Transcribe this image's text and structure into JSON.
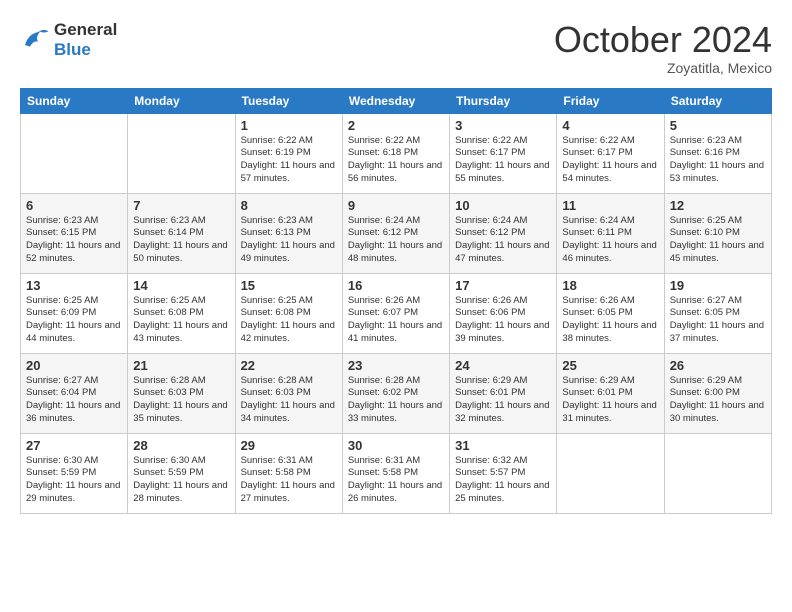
{
  "logo": {
    "line1": "General",
    "line2": "Blue"
  },
  "header": {
    "month": "October 2024",
    "location": "Zoyatitla, Mexico"
  },
  "weekdays": [
    "Sunday",
    "Monday",
    "Tuesday",
    "Wednesday",
    "Thursday",
    "Friday",
    "Saturday"
  ],
  "weeks": [
    [
      {
        "day": "",
        "sunrise": "",
        "sunset": "",
        "daylight": ""
      },
      {
        "day": "",
        "sunrise": "",
        "sunset": "",
        "daylight": ""
      },
      {
        "day": "1",
        "sunrise": "Sunrise: 6:22 AM",
        "sunset": "Sunset: 6:19 PM",
        "daylight": "Daylight: 11 hours and 57 minutes."
      },
      {
        "day": "2",
        "sunrise": "Sunrise: 6:22 AM",
        "sunset": "Sunset: 6:18 PM",
        "daylight": "Daylight: 11 hours and 56 minutes."
      },
      {
        "day": "3",
        "sunrise": "Sunrise: 6:22 AM",
        "sunset": "Sunset: 6:17 PM",
        "daylight": "Daylight: 11 hours and 55 minutes."
      },
      {
        "day": "4",
        "sunrise": "Sunrise: 6:22 AM",
        "sunset": "Sunset: 6:17 PM",
        "daylight": "Daylight: 11 hours and 54 minutes."
      },
      {
        "day": "5",
        "sunrise": "Sunrise: 6:23 AM",
        "sunset": "Sunset: 6:16 PM",
        "daylight": "Daylight: 11 hours and 53 minutes."
      }
    ],
    [
      {
        "day": "6",
        "sunrise": "Sunrise: 6:23 AM",
        "sunset": "Sunset: 6:15 PM",
        "daylight": "Daylight: 11 hours and 52 minutes."
      },
      {
        "day": "7",
        "sunrise": "Sunrise: 6:23 AM",
        "sunset": "Sunset: 6:14 PM",
        "daylight": "Daylight: 11 hours and 50 minutes."
      },
      {
        "day": "8",
        "sunrise": "Sunrise: 6:23 AM",
        "sunset": "Sunset: 6:13 PM",
        "daylight": "Daylight: 11 hours and 49 minutes."
      },
      {
        "day": "9",
        "sunrise": "Sunrise: 6:24 AM",
        "sunset": "Sunset: 6:12 PM",
        "daylight": "Daylight: 11 hours and 48 minutes."
      },
      {
        "day": "10",
        "sunrise": "Sunrise: 6:24 AM",
        "sunset": "Sunset: 6:12 PM",
        "daylight": "Daylight: 11 hours and 47 minutes."
      },
      {
        "day": "11",
        "sunrise": "Sunrise: 6:24 AM",
        "sunset": "Sunset: 6:11 PM",
        "daylight": "Daylight: 11 hours and 46 minutes."
      },
      {
        "day": "12",
        "sunrise": "Sunrise: 6:25 AM",
        "sunset": "Sunset: 6:10 PM",
        "daylight": "Daylight: 11 hours and 45 minutes."
      }
    ],
    [
      {
        "day": "13",
        "sunrise": "Sunrise: 6:25 AM",
        "sunset": "Sunset: 6:09 PM",
        "daylight": "Daylight: 11 hours and 44 minutes."
      },
      {
        "day": "14",
        "sunrise": "Sunrise: 6:25 AM",
        "sunset": "Sunset: 6:08 PM",
        "daylight": "Daylight: 11 hours and 43 minutes."
      },
      {
        "day": "15",
        "sunrise": "Sunrise: 6:25 AM",
        "sunset": "Sunset: 6:08 PM",
        "daylight": "Daylight: 11 hours and 42 minutes."
      },
      {
        "day": "16",
        "sunrise": "Sunrise: 6:26 AM",
        "sunset": "Sunset: 6:07 PM",
        "daylight": "Daylight: 11 hours and 41 minutes."
      },
      {
        "day": "17",
        "sunrise": "Sunrise: 6:26 AM",
        "sunset": "Sunset: 6:06 PM",
        "daylight": "Daylight: 11 hours and 39 minutes."
      },
      {
        "day": "18",
        "sunrise": "Sunrise: 6:26 AM",
        "sunset": "Sunset: 6:05 PM",
        "daylight": "Daylight: 11 hours and 38 minutes."
      },
      {
        "day": "19",
        "sunrise": "Sunrise: 6:27 AM",
        "sunset": "Sunset: 6:05 PM",
        "daylight": "Daylight: 11 hours and 37 minutes."
      }
    ],
    [
      {
        "day": "20",
        "sunrise": "Sunrise: 6:27 AM",
        "sunset": "Sunset: 6:04 PM",
        "daylight": "Daylight: 11 hours and 36 minutes."
      },
      {
        "day": "21",
        "sunrise": "Sunrise: 6:28 AM",
        "sunset": "Sunset: 6:03 PM",
        "daylight": "Daylight: 11 hours and 35 minutes."
      },
      {
        "day": "22",
        "sunrise": "Sunrise: 6:28 AM",
        "sunset": "Sunset: 6:03 PM",
        "daylight": "Daylight: 11 hours and 34 minutes."
      },
      {
        "day": "23",
        "sunrise": "Sunrise: 6:28 AM",
        "sunset": "Sunset: 6:02 PM",
        "daylight": "Daylight: 11 hours and 33 minutes."
      },
      {
        "day": "24",
        "sunrise": "Sunrise: 6:29 AM",
        "sunset": "Sunset: 6:01 PM",
        "daylight": "Daylight: 11 hours and 32 minutes."
      },
      {
        "day": "25",
        "sunrise": "Sunrise: 6:29 AM",
        "sunset": "Sunset: 6:01 PM",
        "daylight": "Daylight: 11 hours and 31 minutes."
      },
      {
        "day": "26",
        "sunrise": "Sunrise: 6:29 AM",
        "sunset": "Sunset: 6:00 PM",
        "daylight": "Daylight: 11 hours and 30 minutes."
      }
    ],
    [
      {
        "day": "27",
        "sunrise": "Sunrise: 6:30 AM",
        "sunset": "Sunset: 5:59 PM",
        "daylight": "Daylight: 11 hours and 29 minutes."
      },
      {
        "day": "28",
        "sunrise": "Sunrise: 6:30 AM",
        "sunset": "Sunset: 5:59 PM",
        "daylight": "Daylight: 11 hours and 28 minutes."
      },
      {
        "day": "29",
        "sunrise": "Sunrise: 6:31 AM",
        "sunset": "Sunset: 5:58 PM",
        "daylight": "Daylight: 11 hours and 27 minutes."
      },
      {
        "day": "30",
        "sunrise": "Sunrise: 6:31 AM",
        "sunset": "Sunset: 5:58 PM",
        "daylight": "Daylight: 11 hours and 26 minutes."
      },
      {
        "day": "31",
        "sunrise": "Sunrise: 6:32 AM",
        "sunset": "Sunset: 5:57 PM",
        "daylight": "Daylight: 11 hours and 25 minutes."
      },
      {
        "day": "",
        "sunrise": "",
        "sunset": "",
        "daylight": ""
      },
      {
        "day": "",
        "sunrise": "",
        "sunset": "",
        "daylight": ""
      }
    ]
  ]
}
